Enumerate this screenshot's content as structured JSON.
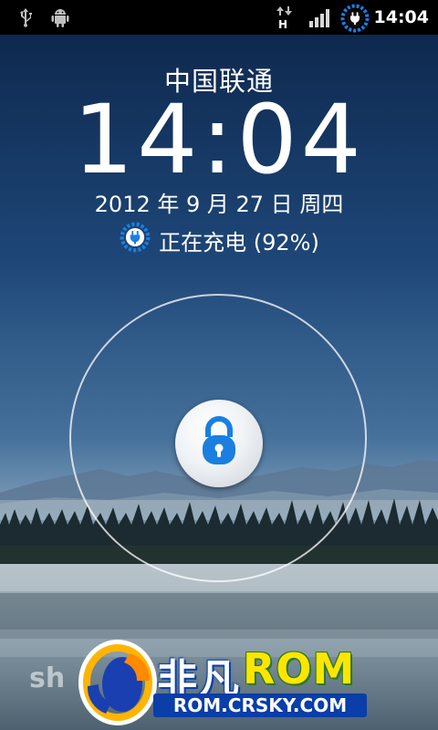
{
  "status_bar": {
    "icons": [
      "usb-icon",
      "android-debug-icon",
      "data-transfer-icon",
      "signal-icon",
      "battery-charging-icon"
    ],
    "time": "14:04",
    "signal_level": 4
  },
  "lockscreen": {
    "carrier": "中国联通",
    "time": "14:04",
    "date": "2012 年 9 月 27 日 周四",
    "charging_text": "正在充电 (92%)",
    "battery_percent": 92
  },
  "unlock": {
    "icon": "lock-icon",
    "accent_color": "#1a7fe0"
  },
  "watermark": {
    "logo_fragment": "sh",
    "brand_cn": "非凡",
    "brand_en": "ROM",
    "url": "ROM.CRSKY.COM"
  },
  "colors": {
    "status_bar": "#000000",
    "sky_top": "#0e2a52",
    "sky_bottom": "#6d8fae",
    "accent": "#1a7fe0"
  }
}
